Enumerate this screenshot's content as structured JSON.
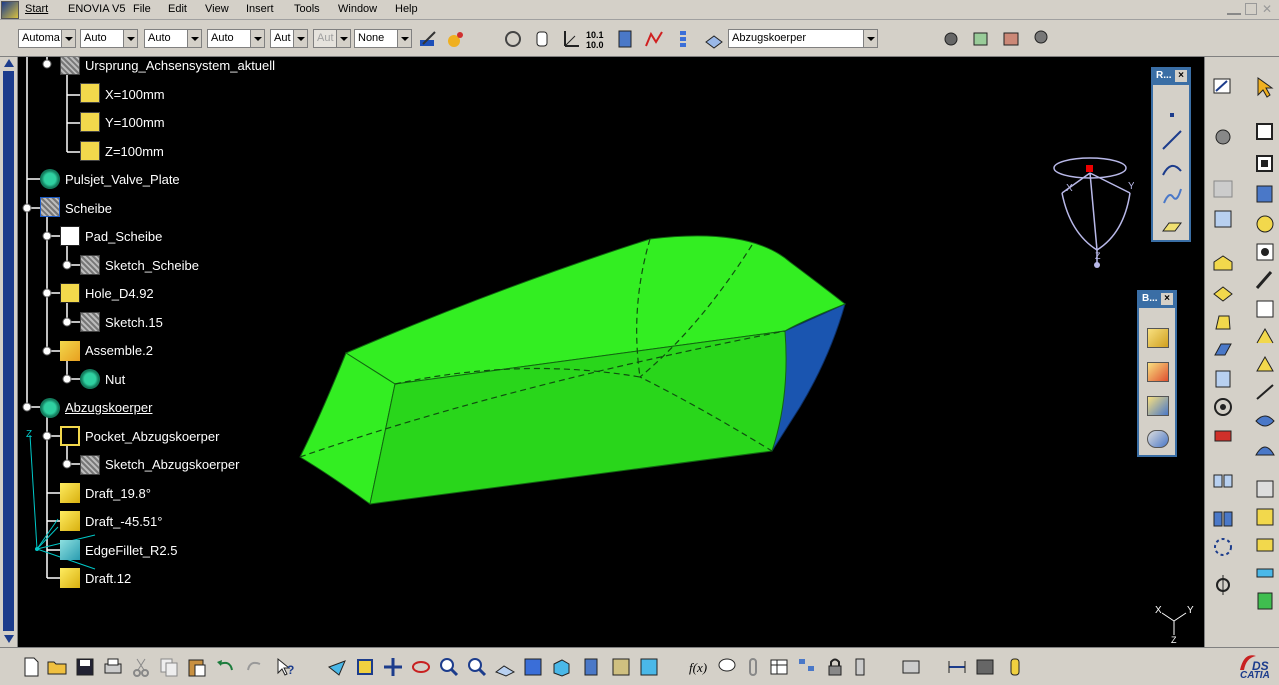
{
  "menubar": {
    "items": [
      "Start",
      "ENOVIA V5",
      "File",
      "Edit",
      "View",
      "Insert",
      "Tools",
      "Window",
      "Help"
    ]
  },
  "toolbar": {
    "combos": [
      "Automa",
      "Auto",
      "Auto",
      "Auto",
      "Aut",
      "Aut",
      "None"
    ],
    "current_body": "Abzugskoerper"
  },
  "tree": {
    "nodes": [
      "Ursprung_Achsensystem_aktuell",
      "X=100mm",
      "Y=100mm",
      "Z=100mm",
      "Pulsjet_Valve_Plate",
      "Scheibe",
      "Pad_Scheibe",
      "Sketch_Scheibe",
      "Hole_D4.92",
      "Sketch.15",
      "Assemble.2",
      "Nut",
      "Abzugskoerper",
      "Pocket_Abzugskoerper",
      "Sketch_Abzugskoerper",
      "Draft_19.8°",
      "Draft_-45.51°",
      "EdgeFillet_R2.5",
      "Draft.12"
    ]
  },
  "panels": {
    "r_title": "R...",
    "b_title": "B...",
    "close": "×"
  },
  "compass": {
    "x": "X",
    "y": "Y",
    "z": "Z"
  },
  "triad": {
    "x": "X",
    "y": "Y",
    "z": "Z"
  },
  "tree_axis": {
    "z": "Z"
  },
  "brand": "CATIA",
  "colors": {
    "viewport_bg": "#000000",
    "part_face": "#33ee22",
    "part_side": "#1a55b0",
    "toolbar_bg": "#d4d0c8",
    "panel_title": "#3a6ea5"
  }
}
